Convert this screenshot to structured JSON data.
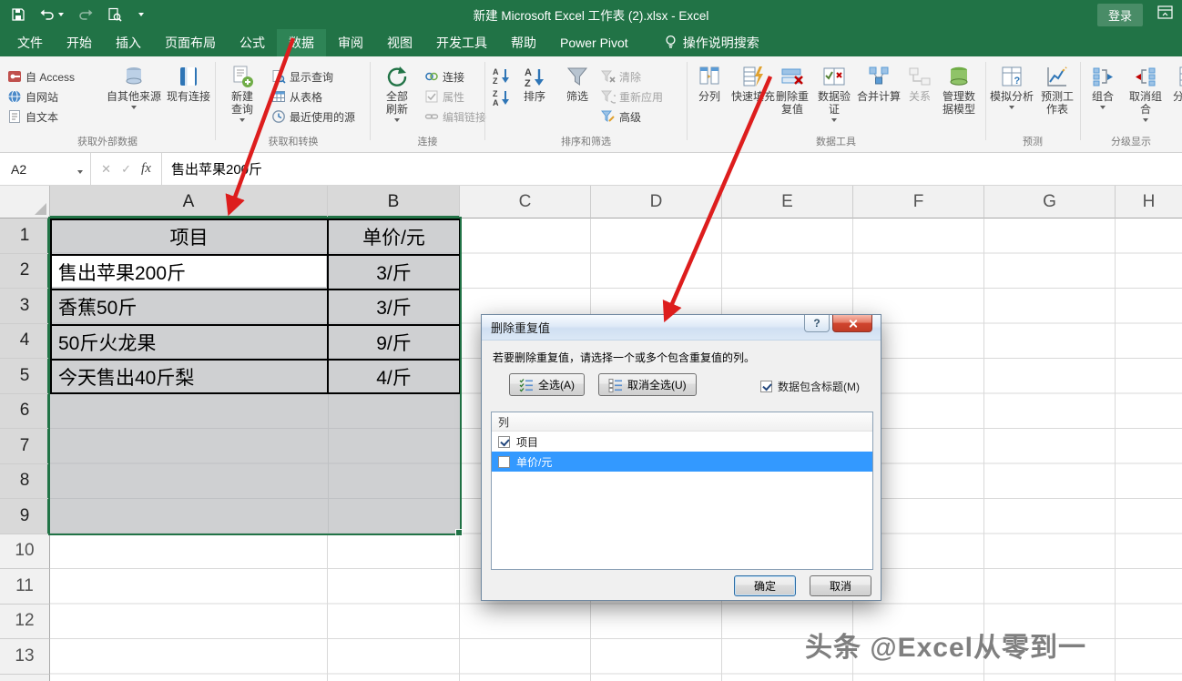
{
  "titlebar": {
    "title": "新建 Microsoft Excel 工作表 (2).xlsx  -  Excel",
    "login": "登录"
  },
  "tabs": {
    "items": [
      "文件",
      "开始",
      "插入",
      "页面布局",
      "公式",
      "数据",
      "审阅",
      "视图",
      "开发工具",
      "帮助",
      "Power Pivot"
    ],
    "selected": "数据",
    "search": "操作说明搜索"
  },
  "ribbon": {
    "external": {
      "label": "获取外部数据",
      "access": "自 Access",
      "web": "自网站",
      "text": "自文本",
      "other": "自其他来源",
      "existing": "现有连接"
    },
    "transform": {
      "label": "获取和转换",
      "new_query": "新建查询",
      "show_queries": "显示查询",
      "from_table": "从表格",
      "recent": "最近使用的源"
    },
    "connections": {
      "label": "连接",
      "refresh_all": "全部刷新",
      "connections": "连接",
      "properties": "属性",
      "edit_links": "编辑链接"
    },
    "sort_filter": {
      "label": "排序和筛选",
      "sort": "排序",
      "filter": "筛选",
      "clear": "清除",
      "reapply": "重新应用",
      "advanced": "高级"
    },
    "tools": {
      "label": "数据工具",
      "text_to_columns": "分列",
      "flash_fill": "快速填充",
      "remove_duplicates": "删除重复值",
      "validation": "数据验证",
      "consolidate": "合并计算",
      "relationships": "关系",
      "manage_model": "管理数据模型"
    },
    "forecast": {
      "label": "预测",
      "what_if": "模拟分析",
      "forecast_sheet": "预测工作表"
    },
    "outline": {
      "label": "分级显示",
      "group": "组合",
      "ungroup": "取消组合",
      "subtotal": "分类汇总"
    }
  },
  "formula_bar": {
    "name_box": "A2",
    "fx": "fx",
    "content": "售出苹果200斤"
  },
  "sheet": {
    "col_headers": [
      "A",
      "B",
      "C",
      "D",
      "E",
      "F",
      "G",
      "H"
    ],
    "row_headers": [
      "1",
      "2",
      "3",
      "4",
      "5",
      "6",
      "7",
      "8",
      "9",
      "10",
      "11",
      "12",
      "13"
    ],
    "selection": "A1:B9",
    "active_cell": "A2",
    "table": {
      "headers": [
        "项目",
        "单价/元"
      ],
      "rows": [
        [
          "售出苹果200斤",
          "3/斤"
        ],
        [
          "香蕉50斤",
          "3/斤"
        ],
        [
          "50斤火龙果",
          "9/斤"
        ],
        [
          "今天售出40斤梨",
          "4/斤"
        ]
      ]
    }
  },
  "dialog": {
    "title": "删除重复值",
    "message": "若要删除重复值，请选择一个或多个包含重复值的列。",
    "select_all": "全选(A)",
    "unselect_all": "取消全选(U)",
    "data_has_headers": "数据包含标题(M)",
    "data_has_headers_checked": true,
    "list_header": "列",
    "columns": [
      {
        "name": "项目",
        "checked": true,
        "selected": false
      },
      {
        "name": "单价/元",
        "checked": false,
        "selected": true
      }
    ],
    "ok": "确定",
    "cancel": "取消"
  },
  "watermark": "头条 @Excel从零到一",
  "colors": {
    "excel_green": "#217346",
    "selection_blue": "#3399ff",
    "arrow_red": "#dd1d1d"
  }
}
